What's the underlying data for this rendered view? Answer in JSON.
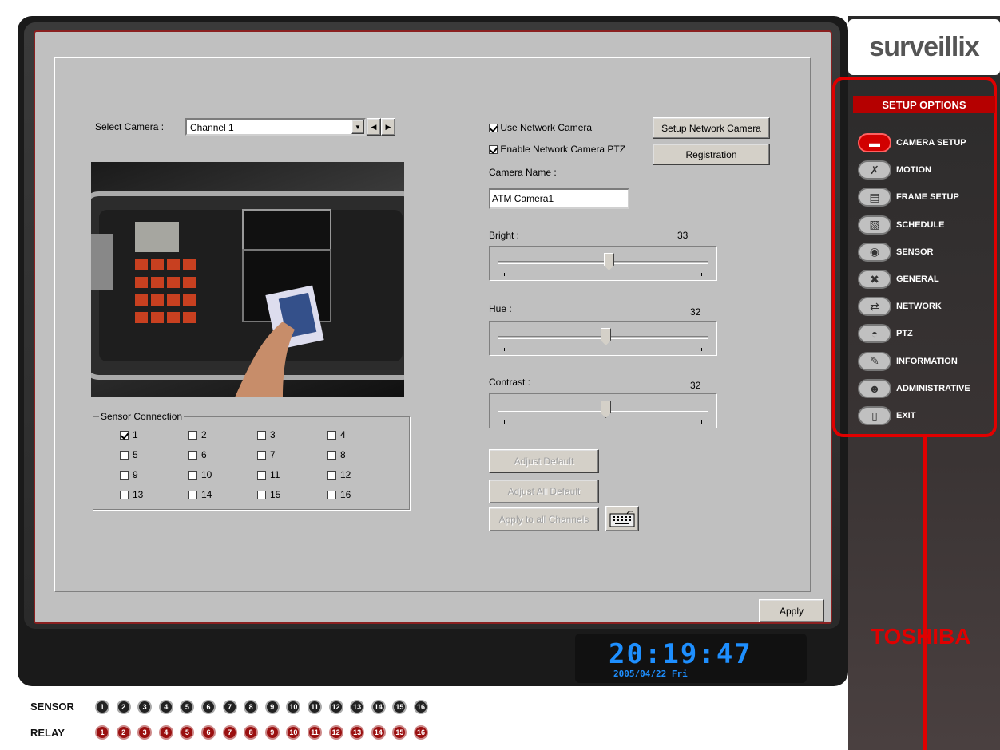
{
  "brand": {
    "logo_text": "surveillix",
    "footer_text": "TOSHIBA"
  },
  "camera": {
    "select_label": "Select Camera :",
    "selected": "Channel 1",
    "use_network": "Use Network Camera",
    "enable_ptz": "Enable Network Camera PTZ",
    "setup_network_button": "Setup Network Camera",
    "registration_button": "Registration",
    "name_label": "Camera Name :",
    "name_value": "ATM Camera1",
    "preview_icon": "atm-camera-preview"
  },
  "sliders": {
    "bright": {
      "label": "Bright :",
      "value": "33"
    },
    "hue": {
      "label": "Hue :",
      "value": "32"
    },
    "contrast": {
      "label": "Contrast :",
      "value": "32"
    }
  },
  "buttons": {
    "adjust_default": "Adjust Default",
    "adjust_all_default": "Adjust All Default",
    "apply_all_channels": "Apply to all Channels",
    "apply": "Apply"
  },
  "sensor_connection": {
    "title": "Sensor Connection",
    "items": [
      "1",
      "2",
      "3",
      "4",
      "5",
      "6",
      "7",
      "8",
      "9",
      "10",
      "11",
      "12",
      "13",
      "14",
      "15",
      "16"
    ],
    "checked": [
      "1"
    ]
  },
  "sidebar": {
    "title": "SETUP OPTIONS",
    "items": [
      {
        "label": "CAMERA SETUP",
        "icon": "camera-icon",
        "active": true
      },
      {
        "label": "MOTION",
        "icon": "running-man-icon"
      },
      {
        "label": "FRAME SETUP",
        "icon": "film-icon"
      },
      {
        "label": "SCHEDULE",
        "icon": "calendar-icon"
      },
      {
        "label": "SENSOR",
        "icon": "sensor-icon"
      },
      {
        "label": "GENERAL",
        "icon": "tools-icon"
      },
      {
        "label": "NETWORK",
        "icon": "network-icon"
      },
      {
        "label": "PTZ",
        "icon": "dome-camera-icon"
      },
      {
        "label": "INFORMATION",
        "icon": "info-icon"
      },
      {
        "label": "ADMINISTRATIVE",
        "icon": "admin-icon"
      },
      {
        "label": "EXIT",
        "icon": "door-icon"
      }
    ]
  },
  "clock": {
    "time": "20:19:47",
    "date": "2005/04/22 Fri"
  },
  "indicators": {
    "sensor_label": "SENSOR",
    "relay_label": "RELAY",
    "numbers": [
      "1",
      "2",
      "3",
      "4",
      "5",
      "6",
      "7",
      "8",
      "9",
      "10",
      "11",
      "12",
      "13",
      "14",
      "15",
      "16"
    ]
  },
  "colors": {
    "accent": "#d10000",
    "clock": "#1e8fff",
    "panel": "#c0c0c0"
  }
}
